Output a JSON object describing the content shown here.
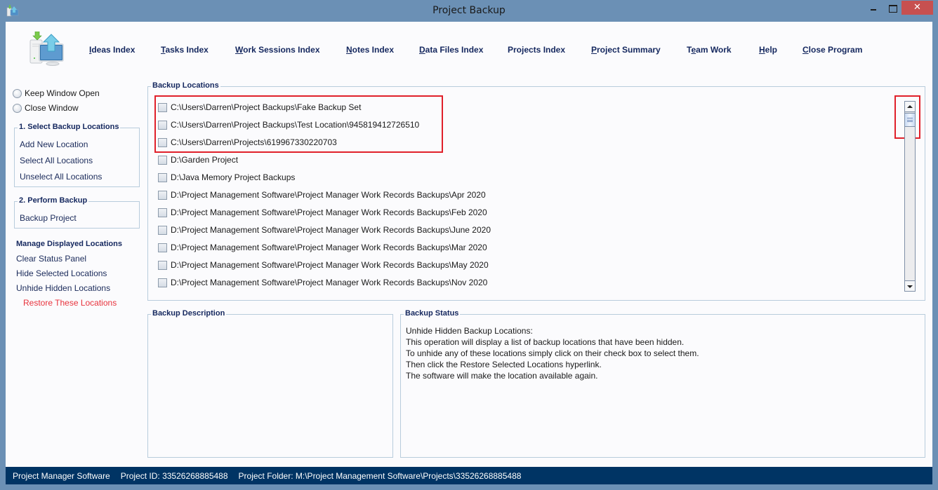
{
  "window": {
    "title": "Project Backup",
    "close_glyph": "✕"
  },
  "nav": {
    "items": [
      {
        "label": "Ideas Index",
        "mnemonic": "I"
      },
      {
        "label": "Tasks Index",
        "mnemonic": "T"
      },
      {
        "label": "Work Sessions Index",
        "mnemonic": "W"
      },
      {
        "label": "Notes Index",
        "mnemonic": "N"
      },
      {
        "label": "Data Files Index",
        "mnemonic": "D"
      },
      {
        "label": "Projects Index",
        "mnemonic": ""
      },
      {
        "label": "Project Summary",
        "mnemonic": "P"
      },
      {
        "label": "Team Work",
        "mnemonic": "e"
      },
      {
        "label": "Help",
        "mnemonic": "H"
      },
      {
        "label": "Close Program",
        "mnemonic": "C"
      }
    ]
  },
  "sidebar": {
    "window_options": [
      {
        "label": "Keep Window Open",
        "selected": false
      },
      {
        "label": "Close Window",
        "selected": false
      }
    ],
    "select_group": {
      "title": "1. Select Backup Locations",
      "links": [
        "Add New Location",
        "Select All Locations",
        "Unselect All Locations"
      ]
    },
    "backup_group": {
      "title": "2. Perform Backup",
      "links": [
        "Backup Project"
      ]
    },
    "manage": {
      "title": "Manage Displayed Locations",
      "links": [
        "Clear Status Panel",
        "Hide Selected Locations",
        "Unhide Hidden Locations"
      ],
      "restore_label": "Restore These Locations",
      "restore_color": "#e8323c"
    }
  },
  "locations": {
    "title": "Backup Locations",
    "items": [
      {
        "path": "C:\\Users\\Darren\\Project Backups\\Fake Backup Set",
        "checked": false
      },
      {
        "path": "C:\\Users\\Darren\\Project Backups\\Test Location\\945819412726510",
        "checked": false
      },
      {
        "path": "C:\\Users\\Darren\\Projects\\619967330220703",
        "checked": false
      },
      {
        "path": "D:\\Garden Project",
        "checked": false
      },
      {
        "path": "D:\\Java Memory Project Backups",
        "checked": false
      },
      {
        "path": "D:\\Project Management Software\\Project Manager Work Records Backups\\Apr 2020",
        "checked": false
      },
      {
        "path": "D:\\Project Management Software\\Project Manager Work Records Backups\\Feb 2020",
        "checked": false
      },
      {
        "path": "D:\\Project Management Software\\Project Manager Work Records Backups\\June 2020",
        "checked": false
      },
      {
        "path": "D:\\Project Management Software\\Project Manager Work Records Backups\\Mar 2020",
        "checked": false
      },
      {
        "path": "D:\\Project Management Software\\Project Manager Work Records Backups\\May 2020",
        "checked": false
      },
      {
        "path": "D:\\Project Management Software\\Project Manager Work Records Backups\\Nov 2020",
        "checked": false
      }
    ],
    "scroll_position": 0
  },
  "description": {
    "title": "Backup Description",
    "text": ""
  },
  "status": {
    "title": "Backup Status",
    "lines": [
      "Unhide Hidden Backup Locations:",
      "This operation will display a list of backup locations that have been hidden.",
      "To unhide any of these locations simply click on their check box to select them.",
      "Then click the Restore Selected Locations hyperlink.",
      "The software will make the location available again."
    ]
  },
  "footer": {
    "app_name": "Project Manager Software",
    "project_id": "Project ID:  33526268885488",
    "project_folder": "Project Folder: M:\\Project Management Software\\Projects\\33526268885488"
  },
  "annotations": {
    "highlight_color": "#e0202a"
  }
}
